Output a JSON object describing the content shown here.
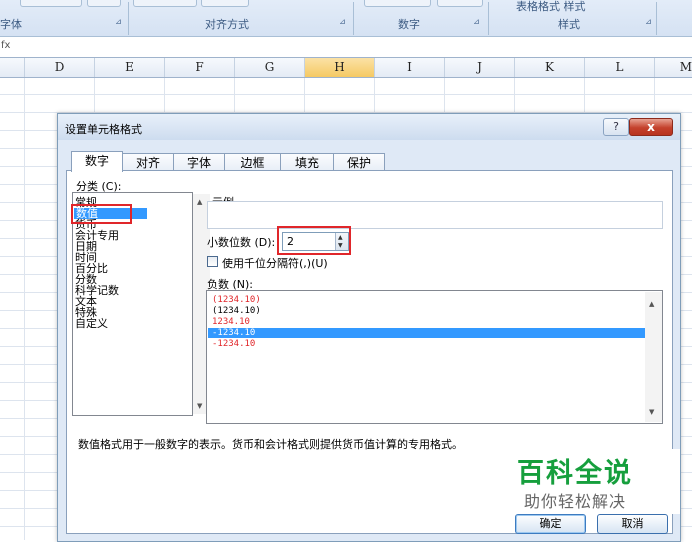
{
  "ribbon": {
    "groups": [
      "字体",
      "对齐方式",
      "数字",
      "样式"
    ],
    "top_right": "表格格式  样式"
  },
  "formula_bar": {
    "fx": "fx"
  },
  "columns": [
    "D",
    "E",
    "F",
    "G",
    "H",
    "I",
    "J",
    "K",
    "L",
    "M"
  ],
  "dialog": {
    "title": "设置单元格格式",
    "help": "?",
    "close": "x",
    "tabs": [
      "数字",
      "对齐",
      "字体",
      "边框",
      "填充",
      "保护"
    ],
    "category_label": "分类 (C):",
    "categories": [
      "常规",
      "数值",
      "货币",
      "会计专用",
      "日期",
      "时间",
      "百分比",
      "分数",
      "科学记数",
      "文本",
      "特殊",
      "自定义"
    ],
    "selected_category": "数值",
    "sample_label": "示例",
    "decimal_label": "小数位数 (D):",
    "decimal_value": "2",
    "thousands_label": "使用千位分隔符(,)(U)",
    "thousands_checked": false,
    "negative_label": "负数 (N):",
    "negative_formats": [
      "(1234.10)",
      "(1234.10)",
      "1234.10",
      "-1234.10",
      "-1234.10"
    ],
    "negative_selected_index": 3,
    "description": "数值格式用于一般数字的表示。货币和会计格式则提供货币值计算的专用格式。",
    "ok": "确定",
    "cancel": "取消"
  },
  "watermark": {
    "title": "百科全说",
    "subtitle": "助你轻松解决"
  },
  "colors": {
    "accent_selection": "#3399ff",
    "highlight_red": "#e0262a",
    "watermark_green": "#169f3d"
  }
}
